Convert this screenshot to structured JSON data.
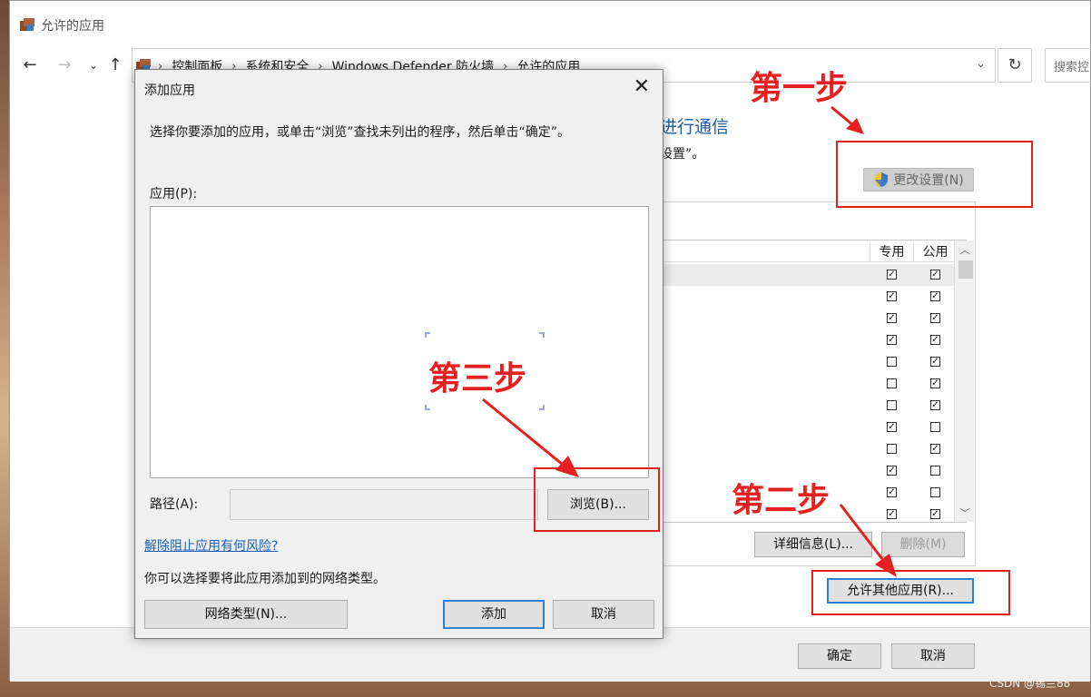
{
  "window": {
    "title": "允许的应用",
    "search_placeholder": "搜索控"
  },
  "breadcrumb": [
    "控制面板",
    "系统和安全",
    "Windows Defender 防火墙",
    "允许的应用"
  ],
  "main": {
    "heading_fragment": "进行通信",
    "desc_fragment": "设置”。",
    "change_settings": "更改设置(N)",
    "columns": {
      "private": "专用",
      "public": "公用"
    },
    "rows": [
      {
        "private": true,
        "public": true
      },
      {
        "private": true,
        "public": true
      },
      {
        "private": true,
        "public": true
      },
      {
        "private": true,
        "public": true
      },
      {
        "private": false,
        "public": true
      },
      {
        "private": false,
        "public": true
      },
      {
        "private": false,
        "public": true
      },
      {
        "private": true,
        "public": false
      },
      {
        "private": false,
        "public": true
      },
      {
        "private": true,
        "public": false
      },
      {
        "private": true,
        "public": false
      },
      {
        "private": true,
        "public": true
      }
    ],
    "details_button": "详细信息(L)...",
    "remove_button": "删除(M)",
    "allow_other_button": "允许其他应用(R)...",
    "ok_button": "确定",
    "cancel_button": "取消"
  },
  "dialog": {
    "title": "添加应用",
    "close": "✕",
    "instruction": "选择你要添加的应用，或单击“浏览”查找未列出的程序，然后单击“确定”。",
    "apps_label": "应用(P):",
    "path_label": "路径(A):",
    "path_value": "",
    "browse_button": "浏览(B)...",
    "risk_link": "解除阻止应用有何风险?",
    "network_text": "你可以选择要将此应用添加到的网络类型。",
    "network_types_button": "网络类型(N)...",
    "add_button": "添加",
    "cancel_button": "取消"
  },
  "annotations": {
    "step1": "第一步",
    "step2": "第二步",
    "step3": "第三步",
    "color": "#e62020"
  },
  "watermark": "CSDN @锡兰88"
}
